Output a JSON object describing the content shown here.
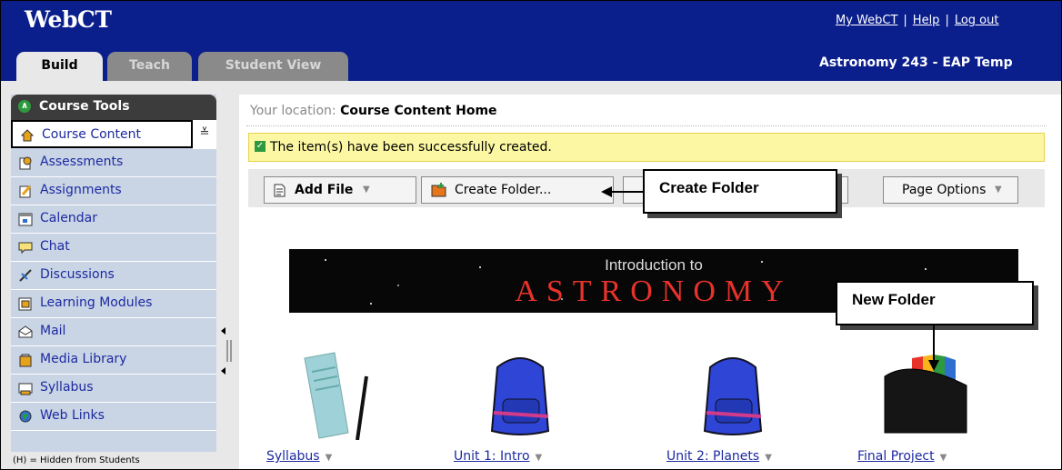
{
  "app": {
    "logo": "WebCT",
    "links": [
      "My WebCT",
      "Help",
      "Log out"
    ],
    "link_separator": "|",
    "course_title": "Astronomy 243 - EAP Temp"
  },
  "tabs": [
    {
      "label": "Build",
      "active": true
    },
    {
      "label": "Teach",
      "active": false
    },
    {
      "label": "Student View",
      "active": false
    }
  ],
  "sidebar": {
    "header": "Course Tools",
    "items": [
      {
        "label": "Course Content",
        "icon": "home-icon",
        "selected": true
      },
      {
        "label": "Assessments",
        "icon": "assessment-icon"
      },
      {
        "label": "Assignments",
        "icon": "assignment-icon"
      },
      {
        "label": "Calendar",
        "icon": "calendar-icon"
      },
      {
        "label": "Chat",
        "icon": "chat-icon"
      },
      {
        "label": "Discussions",
        "icon": "discussion-icon"
      },
      {
        "label": "Learning Modules",
        "icon": "module-icon"
      },
      {
        "label": "Mail",
        "icon": "mail-icon"
      },
      {
        "label": "Media Library",
        "icon": "media-icon"
      },
      {
        "label": "Syllabus",
        "icon": "syllabus-icon"
      },
      {
        "label": "Web Links",
        "icon": "weblink-icon"
      }
    ],
    "footer": "(H) = Hidden from Students",
    "selected_chevron": "≚"
  },
  "content": {
    "location_label": "Your location:",
    "location_value": "Course Content Home",
    "success_message": "The item(s) have been successfully created.",
    "toolbar": {
      "add_file": "Add File",
      "create_folder": "Create Folder...",
      "page_options": "Page Options",
      "dropdown_glyph": "▼"
    },
    "banner": {
      "line1": "Introduction to",
      "line2": "ASTRONOMY"
    },
    "items": [
      {
        "label": "Syllabus",
        "icon": "syllabus-document-icon"
      },
      {
        "label": "Unit 1: Intro",
        "icon": "backpack-icon"
      },
      {
        "label": "Unit 2: Planets",
        "icon": "backpack-icon"
      },
      {
        "label": "Final Project",
        "icon": "file-folder-icon"
      }
    ]
  },
  "callouts": {
    "create_folder": "Create Folder",
    "new_folder": "New Folder"
  },
  "colors": {
    "header_bg": "#0b1f8c",
    "sidebar_bg": "#c9d4e5",
    "success_bg": "#fcf7a3",
    "link": "#1c2aa0"
  }
}
